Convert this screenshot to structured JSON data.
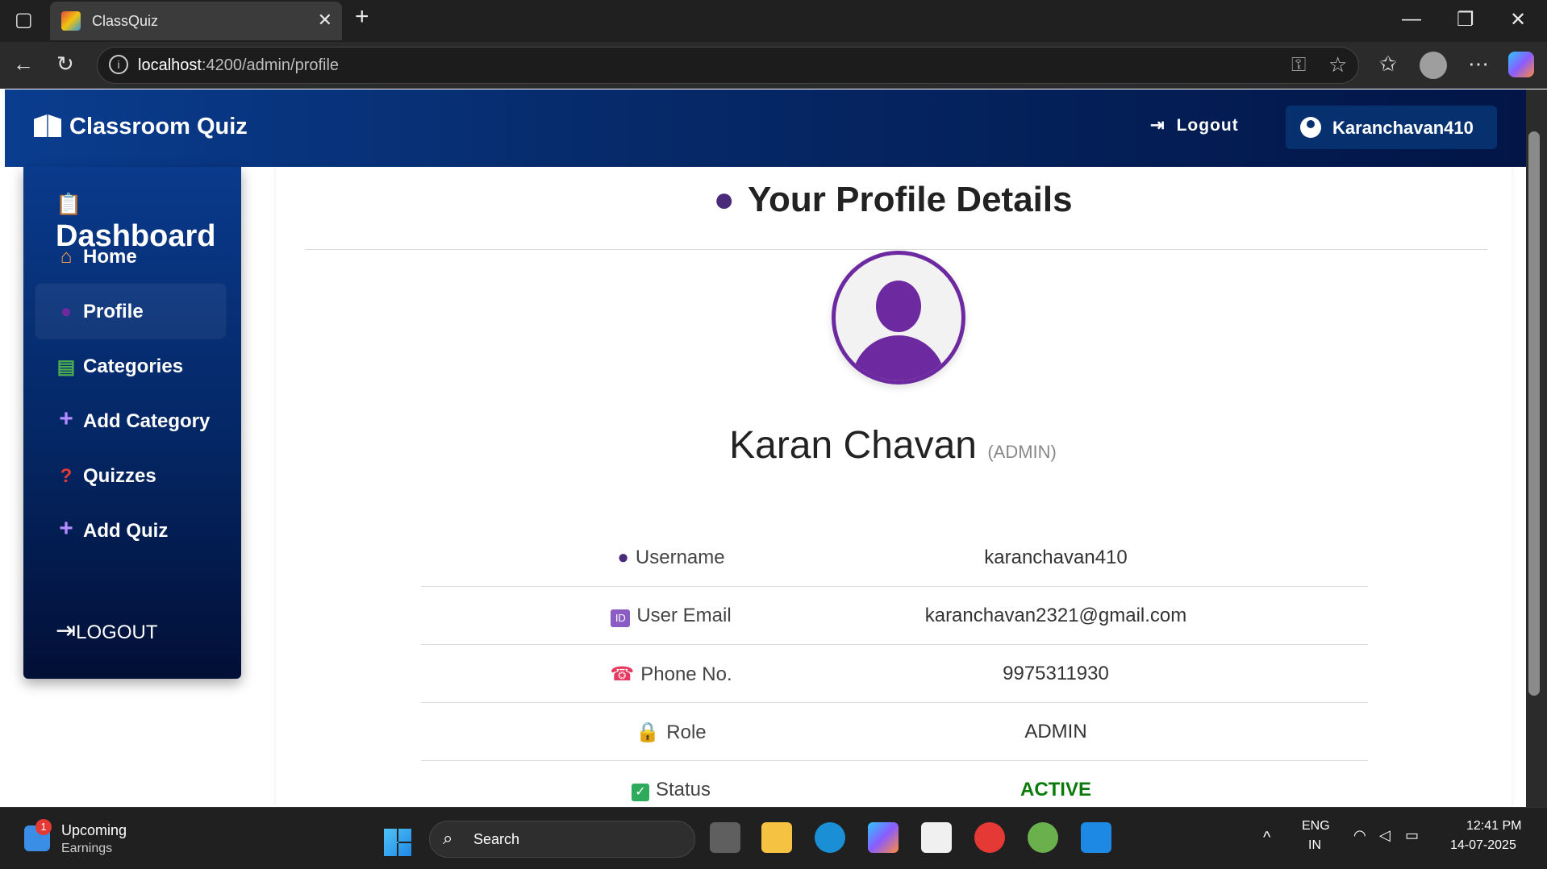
{
  "browser": {
    "tab_title": "ClassQuiz",
    "url_host": "localhost",
    "url_path": ":4200/admin/profile"
  },
  "navbar": {
    "brand": "Classroom Quiz",
    "logout_label": "Logout",
    "username": "Karanchavan410"
  },
  "sidebar": {
    "title": "Dashboard",
    "items": [
      {
        "label": "Home",
        "icon": "house-icon"
      },
      {
        "label": "Profile",
        "icon": "user-icon"
      },
      {
        "label": "Categories",
        "icon": "books-icon"
      },
      {
        "label": "Add Category",
        "icon": "plus-icon"
      },
      {
        "label": "Quizzes",
        "icon": "question-icon"
      },
      {
        "label": "Add Quiz",
        "icon": "plus-icon"
      }
    ],
    "logout_label": "LOGOUT"
  },
  "profile": {
    "title": "Your Profile Details",
    "full_name": "Karan Chavan",
    "role_tag": "(ADMIN)",
    "rows": [
      {
        "label": "Username",
        "value": "karanchavan410"
      },
      {
        "label": "User Email",
        "value": "karanchavan2321@gmail.com"
      },
      {
        "label": "Phone No.",
        "value": "9975311930"
      },
      {
        "label": "Role",
        "value": "ADMIN"
      },
      {
        "label": "Status",
        "value": "ACTIVE"
      }
    ],
    "status_color": "#0a7a0a",
    "accent_color": "#6d2aa0"
  },
  "taskbar": {
    "widget_title": "Upcoming",
    "widget_sub": "Earnings",
    "widget_badge": "1",
    "search_label": "Search",
    "lang_top": "ENG",
    "lang_bottom": "IN",
    "time": "12:41 PM",
    "date": "14-07-2025"
  }
}
